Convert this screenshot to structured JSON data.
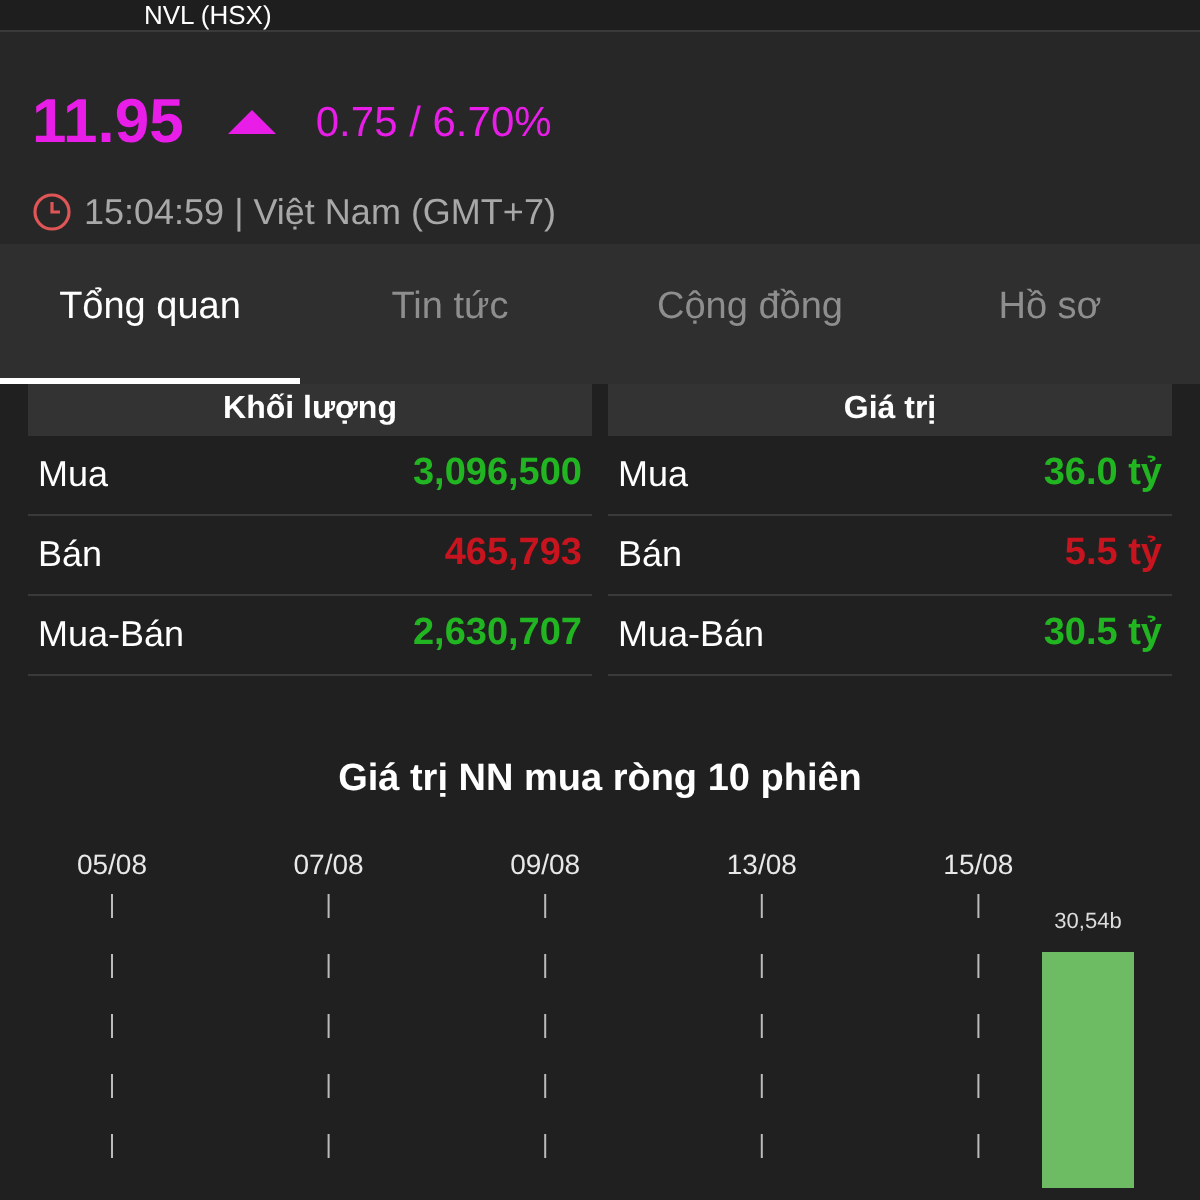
{
  "header": {
    "title": "NVL (HSX)"
  },
  "quote": {
    "price": "11.95",
    "rising": true,
    "change": "0.75 / 6.70%",
    "time": "15:04:59 | Việt Nam (GMT+7)"
  },
  "tabs": [
    {
      "label": "Tổng quan",
      "selected": true
    },
    {
      "label": "Tin tức",
      "selected": false
    },
    {
      "label": "Cộng đồng",
      "selected": false
    },
    {
      "label": "Hồ sơ",
      "selected": false
    }
  ],
  "tables": [
    {
      "title": "Khối lượng",
      "rows": [
        {
          "label": "Mua",
          "value": "3,096,500",
          "color": "#22b522"
        },
        {
          "label": "Bán",
          "value": "465,793",
          "color": "#c8141e"
        },
        {
          "label": "Mua-Bán",
          "value": "2,630,707",
          "color": "#22b522"
        }
      ]
    },
    {
      "title": "Giá trị",
      "rows": [
        {
          "label": "Mua",
          "value": "36.0 tỷ",
          "color": "#22b522"
        },
        {
          "label": "Bán",
          "value": "5.5 tỷ",
          "color": "#c8141e"
        },
        {
          "label": "Mua-Bán",
          "value": "30.5 tỷ",
          "color": "#22b522"
        }
      ]
    }
  ],
  "chart": {
    "title": "Giá trị NN mua ròng 10 phiên",
    "date_labels": [
      "05/08",
      "07/08",
      "09/08",
      "13/08",
      "15/08"
    ],
    "bar_label": "30,54b"
  }
}
